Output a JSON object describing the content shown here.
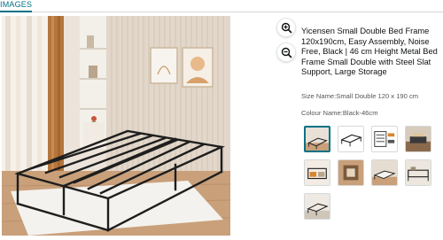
{
  "tabs": {
    "images_label": "IMAGES"
  },
  "product": {
    "title": "Yicensen Small Double Bed Frame 120x190cm, Easy Assembly, Noise Free, Black | 46 cm Height Metal Bed Frame Small Double with Steel Slat Support, Large Storage",
    "size_label": "Size Name:",
    "size_value": "Small Double 120 x 190 cm",
    "colour_label": "Colour Name:",
    "colour_value": "Black-46cm"
  },
  "zoom": {
    "zoom_in_icon": "zoom-in-icon",
    "zoom_out_icon": "zoom-out-icon"
  },
  "thumbnails": {
    "count": 9,
    "selected_index": 0
  },
  "colors": {
    "accent": "#007185",
    "text": "#0f1111",
    "muted": "#565959"
  }
}
